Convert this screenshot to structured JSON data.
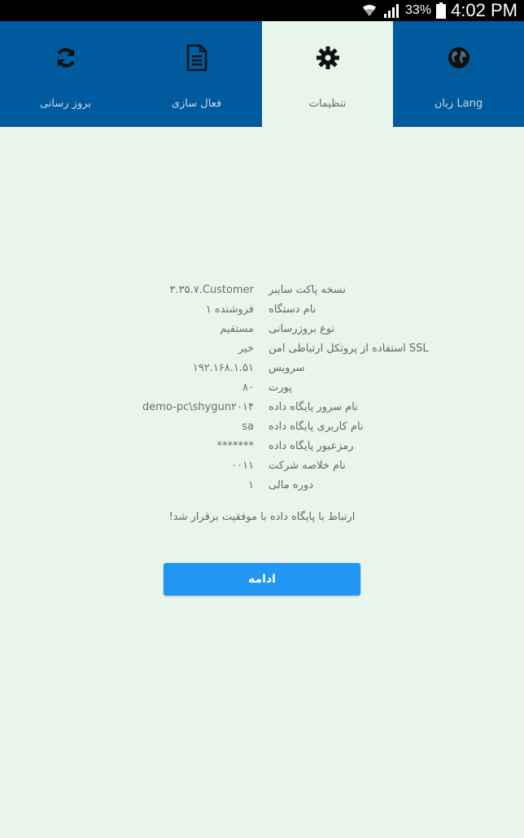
{
  "status_bar": {
    "battery_pct": "33%",
    "time": "4:02 PM",
    "icons": [
      "wifi-icon",
      "signal-icon",
      "battery-icon"
    ]
  },
  "tabs": [
    {
      "label": "بروز رسانی",
      "icon": "refresh-icon",
      "active": false
    },
    {
      "label": "فعال سازی",
      "icon": "document-icon",
      "active": false
    },
    {
      "label": "تنظیمات",
      "icon": "gear-icon",
      "active": true
    },
    {
      "label": "زبان Lang",
      "icon": "globe-icon",
      "active": false
    }
  ],
  "info_rows": [
    {
      "key": "نسخه پاکت سایبر",
      "value": "۳.۳۵.۷.Customer"
    },
    {
      "key": "نام دستگاه",
      "value": "فروشنده ۱"
    },
    {
      "key": "نوع بروزرسانی",
      "value": "مستقیم"
    },
    {
      "key": "استفاده از پروتکل ارتباطی امن SSL",
      "value": "خیر"
    },
    {
      "key": "سرویس",
      "value": "۱۹۲.۱۶۸.۱.۵۱"
    },
    {
      "key": "پورت",
      "value": "۸۰"
    },
    {
      "key": "نام سرور پایگاه داده",
      "value": "demo-pc\\shygun۲۰۱۴"
    },
    {
      "key": "نام کاربری پایگاه داده",
      "value": "sa"
    },
    {
      "key": "رمزعبور پایگاه داده",
      "value": "*******"
    },
    {
      "key": "نام خلاصه شرکت",
      "value": "۰۰۱۱"
    },
    {
      "key": "دوره مالی",
      "value": "۱"
    }
  ],
  "message": "ارتباط با پایگاه داده با موفقیت برقرار شد!",
  "continue_label": "ادامه",
  "colors": {
    "tab_bg": "#005a9e",
    "page_bg": "#e8f5ea",
    "button_bg": "#2196f3"
  }
}
